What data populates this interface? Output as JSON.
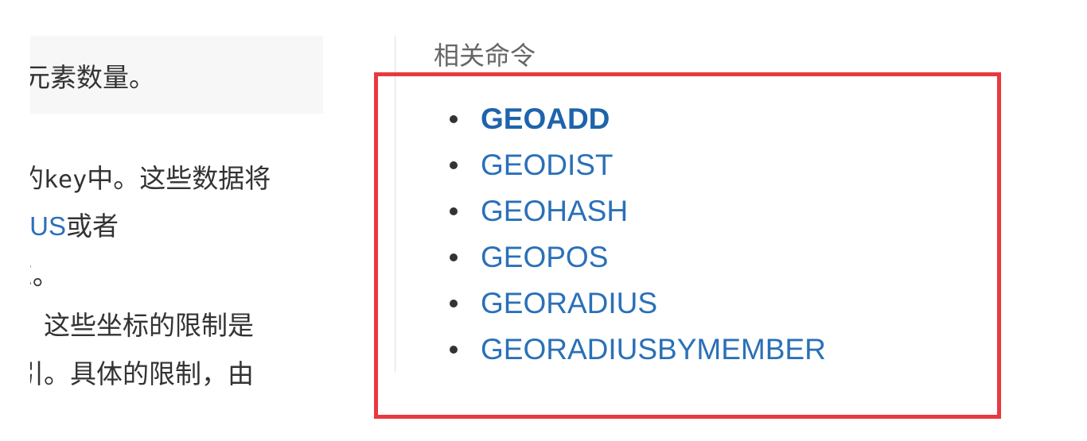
{
  "left_content": {
    "code_snippet": "元素数量。",
    "para_lines": [
      {
        "prefix": "的",
        "mono": "key",
        "suffix": "中。这些数据将"
      },
      {
        "link": "IUS",
        "suffix": "或者"
      },
      {
        "text": "E。"
      },
      {
        "text": "。这些坐标的限制是"
      },
      {
        "text": "引。具体的限制，由"
      }
    ]
  },
  "related": {
    "title": "相关命令",
    "commands": [
      {
        "label": "GEOADD",
        "current": true
      },
      {
        "label": "GEODIST",
        "current": false
      },
      {
        "label": "GEOHASH",
        "current": false
      },
      {
        "label": "GEOPOS",
        "current": false
      },
      {
        "label": "GEORADIUS",
        "current": false
      },
      {
        "label": "GEORADIUSBYMEMBER",
        "current": false
      }
    ]
  },
  "colors": {
    "link": "#2a70b8",
    "highlight_border": "#e8393f",
    "code_background": "#f7f7f7"
  },
  "icons": {
    "list_bullet": "bullet-dot-icon"
  }
}
